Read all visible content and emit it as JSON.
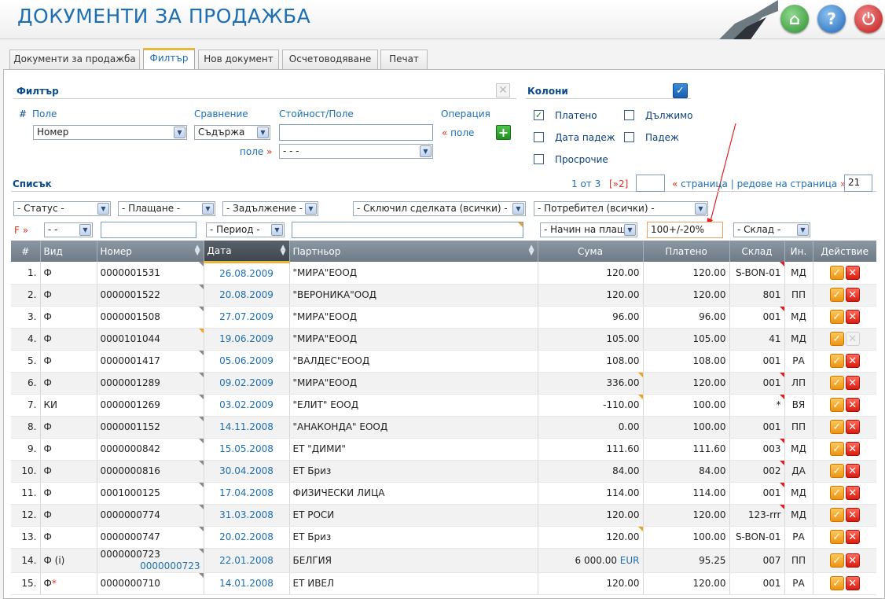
{
  "header": {
    "title": "ДОКУМЕНТИ ЗА ПРОДАЖБА",
    "home_icon": "⌂",
    "help_icon": "?",
    "power_icon": "⏻"
  },
  "tabs": [
    "Документи за продажба",
    "Филтър",
    "Нов документ",
    "Осчетоводяване",
    "Печат"
  ],
  "active_tab": "Филтър",
  "filter": {
    "title": "Филтър",
    "hash": "#",
    "col_field": "Поле",
    "col_compare": "Сравнение",
    "col_value": "Стойност/Поле",
    "col_operation": "Операция",
    "field_value": "Номер",
    "compare_value": "Съдържа",
    "value_input": "",
    "field_link": "поле",
    "field_link_prefix": "«",
    "field_link2": "поле",
    "field_link2_suffix": "»",
    "second_select": "- - -"
  },
  "columns": {
    "title": "Колони",
    "items": [
      {
        "label": "Платено",
        "checked": true
      },
      {
        "label": "Дължимо",
        "checked": false
      },
      {
        "label": "Дата падеж",
        "checked": false
      },
      {
        "label": "Падеж",
        "checked": false
      },
      {
        "label": "Просрочие",
        "checked": false
      }
    ]
  },
  "list": {
    "title": "Списък",
    "page_info": "1 от 3",
    "next_page": "[»2]",
    "page_input": "",
    "prev": "«",
    "page_label": "страница",
    "sep": "|",
    "rows_label": "редове на страница",
    "rows_suffix": "»",
    "rows_per_page": "21"
  },
  "toolbar_selects": [
    "- Статус -",
    "- Плащане -",
    "- Задължение -",
    "- Сключил сделката (всички) -",
    "- Потребител (всички) -"
  ],
  "filter_row": {
    "f_label": "F »",
    "vid": "- -",
    "period": "- Период -",
    "payment_method": "- Начин на плащ",
    "amount": "100+/-20%",
    "warehouse": "- Склад -"
  },
  "grid_headers": [
    "#",
    "Вид",
    "Номер",
    "Дата",
    "Партньор",
    "Сума",
    "Платено",
    "Склад",
    "Ин.",
    "Действие"
  ],
  "rows": [
    {
      "n": "1.",
      "vid": "Ф",
      "num": "0000001531",
      "num2": "",
      "date": "26.08.2009",
      "partner": "\"МИРА\"ЕООД",
      "sum": "120.00",
      "cur": "",
      "paid": "120.00",
      "wh": "S-BON-01",
      "in": "МД",
      "del_enabled": true
    },
    {
      "n": "2.",
      "vid": "Ф",
      "num": "0000001522",
      "num2": "",
      "date": "20.08.2009",
      "partner": "\"ВЕРОНИКА\"ООД",
      "sum": "120.00",
      "cur": "",
      "paid": "120.00",
      "wh": "801",
      "in": "ПП",
      "del_enabled": true
    },
    {
      "n": "3.",
      "vid": "Ф",
      "num": "0000001508",
      "num2": "",
      "date": "27.07.2009",
      "partner": "\"МИРА\"ЕООД",
      "sum": "96.00",
      "cur": "",
      "paid": "96.00",
      "wh": "001",
      "in": "МД",
      "del_enabled": true
    },
    {
      "n": "4.",
      "vid": "Ф",
      "num": "0000101044",
      "num2": "",
      "date": "19.06.2009",
      "partner": "\"МИРА\"ЕООД",
      "sum": "105.00",
      "cur": "",
      "paid": "105.00",
      "wh": "41",
      "in": "МД",
      "del_enabled": false
    },
    {
      "n": "5.",
      "vid": "Ф",
      "num": "0000001417",
      "num2": "",
      "date": "05.06.2009",
      "partner": "\"ВАЛДЕС\"ЕООД",
      "sum": "108.00",
      "cur": "",
      "paid": "108.00",
      "wh": "001",
      "in": "РА",
      "del_enabled": true
    },
    {
      "n": "6.",
      "vid": "Ф",
      "num": "0000001289",
      "num2": "",
      "date": "09.02.2009",
      "partner": "\"МИРА\"ЕООД",
      "sum": "336.00",
      "cur": "",
      "paid": "120.00",
      "wh": "001",
      "in": "ЛП",
      "del_enabled": true
    },
    {
      "n": "7.",
      "vid": "КИ",
      "num": "0000001269",
      "num2": "",
      "date": "03.02.2009",
      "partner": "\"ЕЛИТ\" ЕООД",
      "sum": "-110.00",
      "cur": "",
      "paid": "100.00",
      "wh": "*",
      "in": "ВЯ",
      "del_enabled": true
    },
    {
      "n": "8.",
      "vid": "Ф",
      "num": "0000001152",
      "num2": "",
      "date": "14.11.2008",
      "partner": "\"АНАКОНДА\" ЕООД",
      "sum": "0.00",
      "cur": "",
      "paid": "100.00",
      "wh": "001",
      "in": "ПП",
      "del_enabled": true
    },
    {
      "n": "9.",
      "vid": "Ф",
      "num": "0000000842",
      "num2": "",
      "date": "15.05.2008",
      "partner": "ЕТ \"ДИМИ\"",
      "sum": "111.60",
      "cur": "",
      "paid": "111.60",
      "wh": "003",
      "in": "МД",
      "del_enabled": true
    },
    {
      "n": "10.",
      "vid": "Ф",
      "num": "0000000816",
      "num2": "",
      "date": "30.04.2008",
      "partner": "ЕТ Бриз",
      "sum": "84.00",
      "cur": "",
      "paid": "84.00",
      "wh": "002",
      "in": "ДА",
      "del_enabled": true
    },
    {
      "n": "11.",
      "vid": "Ф",
      "num": "0001000125",
      "num2": "",
      "date": "17.04.2008",
      "partner": "ФИЗИЧЕСКИ ЛИЦА",
      "sum": "114.00",
      "cur": "",
      "paid": "114.00",
      "wh": "001",
      "in": "МД",
      "del_enabled": true
    },
    {
      "n": "12.",
      "vid": "Ф",
      "num": "0000000774",
      "num2": "",
      "date": "31.03.2008",
      "partner": "ЕТ РОСИ",
      "sum": "120.00",
      "cur": "",
      "paid": "120.00",
      "wh": "123-rrr",
      "in": "МД",
      "del_enabled": true
    },
    {
      "n": "13.",
      "vid": "Ф",
      "num": "0000000747",
      "num2": "",
      "date": "20.02.2008",
      "partner": "ЕТ Бриз",
      "sum": "120.00",
      "cur": "",
      "paid": "100.00",
      "wh": "S-BON-01",
      "in": "РА",
      "del_enabled": true
    },
    {
      "n": "14.",
      "vid": "Ф (i)",
      "num": "0000000723",
      "num2": "0000000723",
      "date": "22.01.2008",
      "partner": "БЕЛГИЯ",
      "sum": "6 000.00",
      "cur": "EUR",
      "paid": "95.25",
      "wh": "007",
      "in": "ПП",
      "del_enabled": true
    },
    {
      "n": "15.",
      "vid": "Ф",
      "num": "0000000710",
      "num2": "",
      "date": "14.01.2008",
      "partner": "ЕТ ИВЕЛ",
      "sum": "120.00",
      "cur": "",
      "paid": "120.00",
      "wh": "001",
      "in": "РА",
      "del_enabled": true
    }
  ]
}
